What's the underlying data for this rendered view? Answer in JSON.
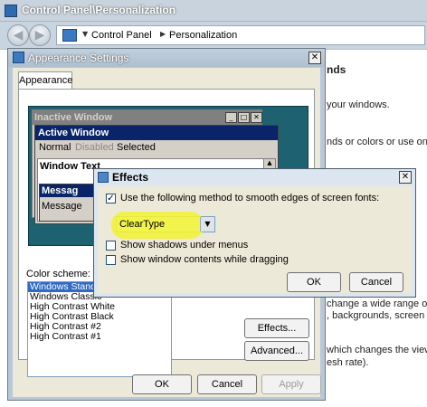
{
  "control_panel": {
    "title": "Control Panel\\Personalization",
    "breadcrumb": [
      "Control Panel",
      "Personalization"
    ],
    "background_text": [
      "nds",
      "your windows.",
      "nds or colors or use one c",
      "change a wide range of v",
      ", backgrounds, screen sa",
      "which changes the view s",
      "esh rate)."
    ]
  },
  "appearance": {
    "title": "Appearance Settings",
    "tab": "Appearance",
    "preview": {
      "inactive_title": "Inactive Window",
      "active_title": "Active Window",
      "menu_normal": "Normal",
      "menu_disabled": "Disabled",
      "menu_selected": "Selected",
      "window_text": "Window Text",
      "msg_title": "Messag",
      "msg_text": "Message"
    },
    "scheme_label": "Color scheme:",
    "schemes": [
      "Windows Standa",
      "Windows Classic",
      "High Contrast White",
      "High Contrast Black",
      "High Contrast #2",
      "High Contrast #1"
    ],
    "buttons": {
      "effects": "Effects...",
      "advanced": "Advanced...",
      "ok": "OK",
      "cancel": "Cancel",
      "apply": "Apply"
    }
  },
  "effects": {
    "title": "Effects",
    "smooth_label": "Use the following method to smooth edges of screen fonts:",
    "smooth_checked": true,
    "method": "ClearType",
    "shadows_label": "Show shadows under menus",
    "shadows_checked": false,
    "dragging_label": "Show window contents while dragging",
    "dragging_checked": false,
    "buttons": {
      "ok": "OK",
      "cancel": "Cancel"
    }
  },
  "colors": {
    "preview_bg": "#1e6170",
    "active_title": "#0a246a",
    "highlight": "#f2f23a",
    "selection": "#316ac5"
  }
}
